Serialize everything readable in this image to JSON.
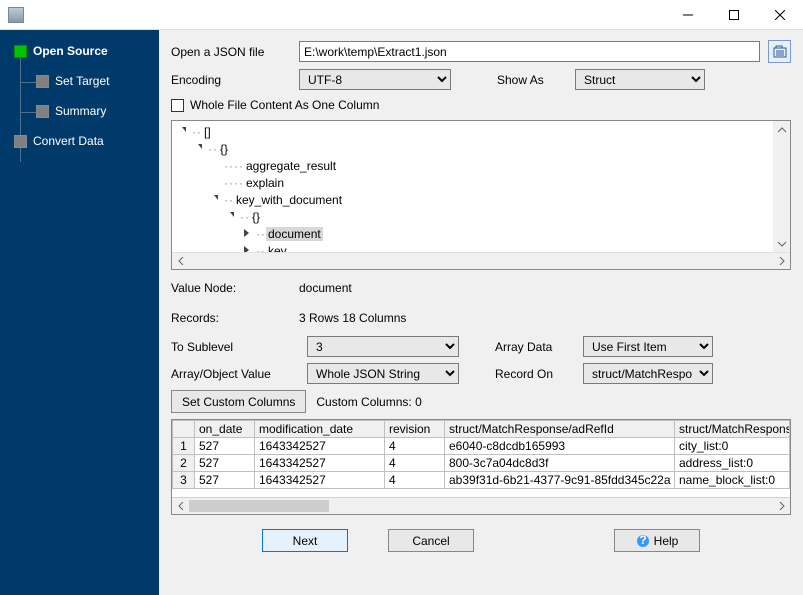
{
  "sidebar": {
    "items": [
      {
        "label": "Open Source",
        "active": true,
        "level": 0
      },
      {
        "label": "Set Target",
        "active": false,
        "level": 1
      },
      {
        "label": "Summary",
        "active": false,
        "level": 1
      },
      {
        "label": "Convert Data",
        "active": false,
        "level": 0
      }
    ]
  },
  "open_file": {
    "label": "Open a JSON file",
    "value": "E:\\work\\temp\\Extract1.json"
  },
  "encoding": {
    "label": "Encoding",
    "value": "UTF-8"
  },
  "show_as": {
    "label": "Show As",
    "value": "Struct"
  },
  "whole_file_checkbox": "Whole File Content As One Column",
  "tree": {
    "n0": "[]",
    "n1": "{}",
    "n2": "aggregate_result",
    "n3": "explain",
    "n4": "key_with_document",
    "n5": "{}",
    "n6": "document",
    "n7": "key"
  },
  "value_node": {
    "label": "Value Node:",
    "value": "document"
  },
  "records": {
    "label": "Records:",
    "value": "3 Rows    18 Columns"
  },
  "sublevel": {
    "label": "To Sublevel",
    "value": "3"
  },
  "array_data": {
    "label": "Array Data",
    "value": "Use First Item"
  },
  "array_value": {
    "label": "Array/Object Value",
    "value": "Whole JSON String"
  },
  "record_on": {
    "label": "Record On",
    "value": "struct/MatchRespons"
  },
  "custom_cols": {
    "button": "Set Custom Columns",
    "label": "Custom Columns: 0"
  },
  "grid": {
    "headers": [
      "",
      "on_date",
      "modification_date",
      "revision",
      "struct/MatchResponse/adRefId",
      "struct/MatchResponse/"
    ],
    "rows": [
      [
        "1",
        "527",
        "1643342527",
        "4",
        "e6040-c8dcdb165993",
        "city_list:0"
      ],
      [
        "2",
        "527",
        "1643342527",
        "4",
        "800-3c7a04dc8d3f",
        "address_list:0"
      ],
      [
        "3",
        "527",
        "1643342527",
        "4",
        "ab39f31d-6b21-4377-9c91-85fdd345c22a",
        "name_block_list:0"
      ]
    ]
  },
  "footer": {
    "next": "Next",
    "cancel": "Cancel",
    "help": "Help"
  }
}
